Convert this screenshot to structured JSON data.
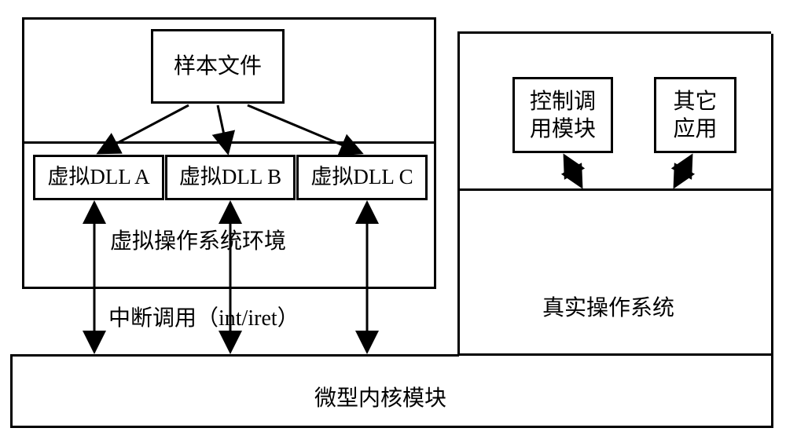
{
  "sample_file": "样本文件",
  "dll_a": "虚拟DLL A",
  "dll_b": "虚拟DLL B",
  "dll_c": "虚拟DLL C",
  "virtual_env_label": "虚拟操作系统环境",
  "interrupt_label": "中断调用（int/iret）",
  "control_module": "控制调\n用模块",
  "other_app": "其它\n应用",
  "real_os": "真实操作系统",
  "microkernel": "微型内核模块"
}
